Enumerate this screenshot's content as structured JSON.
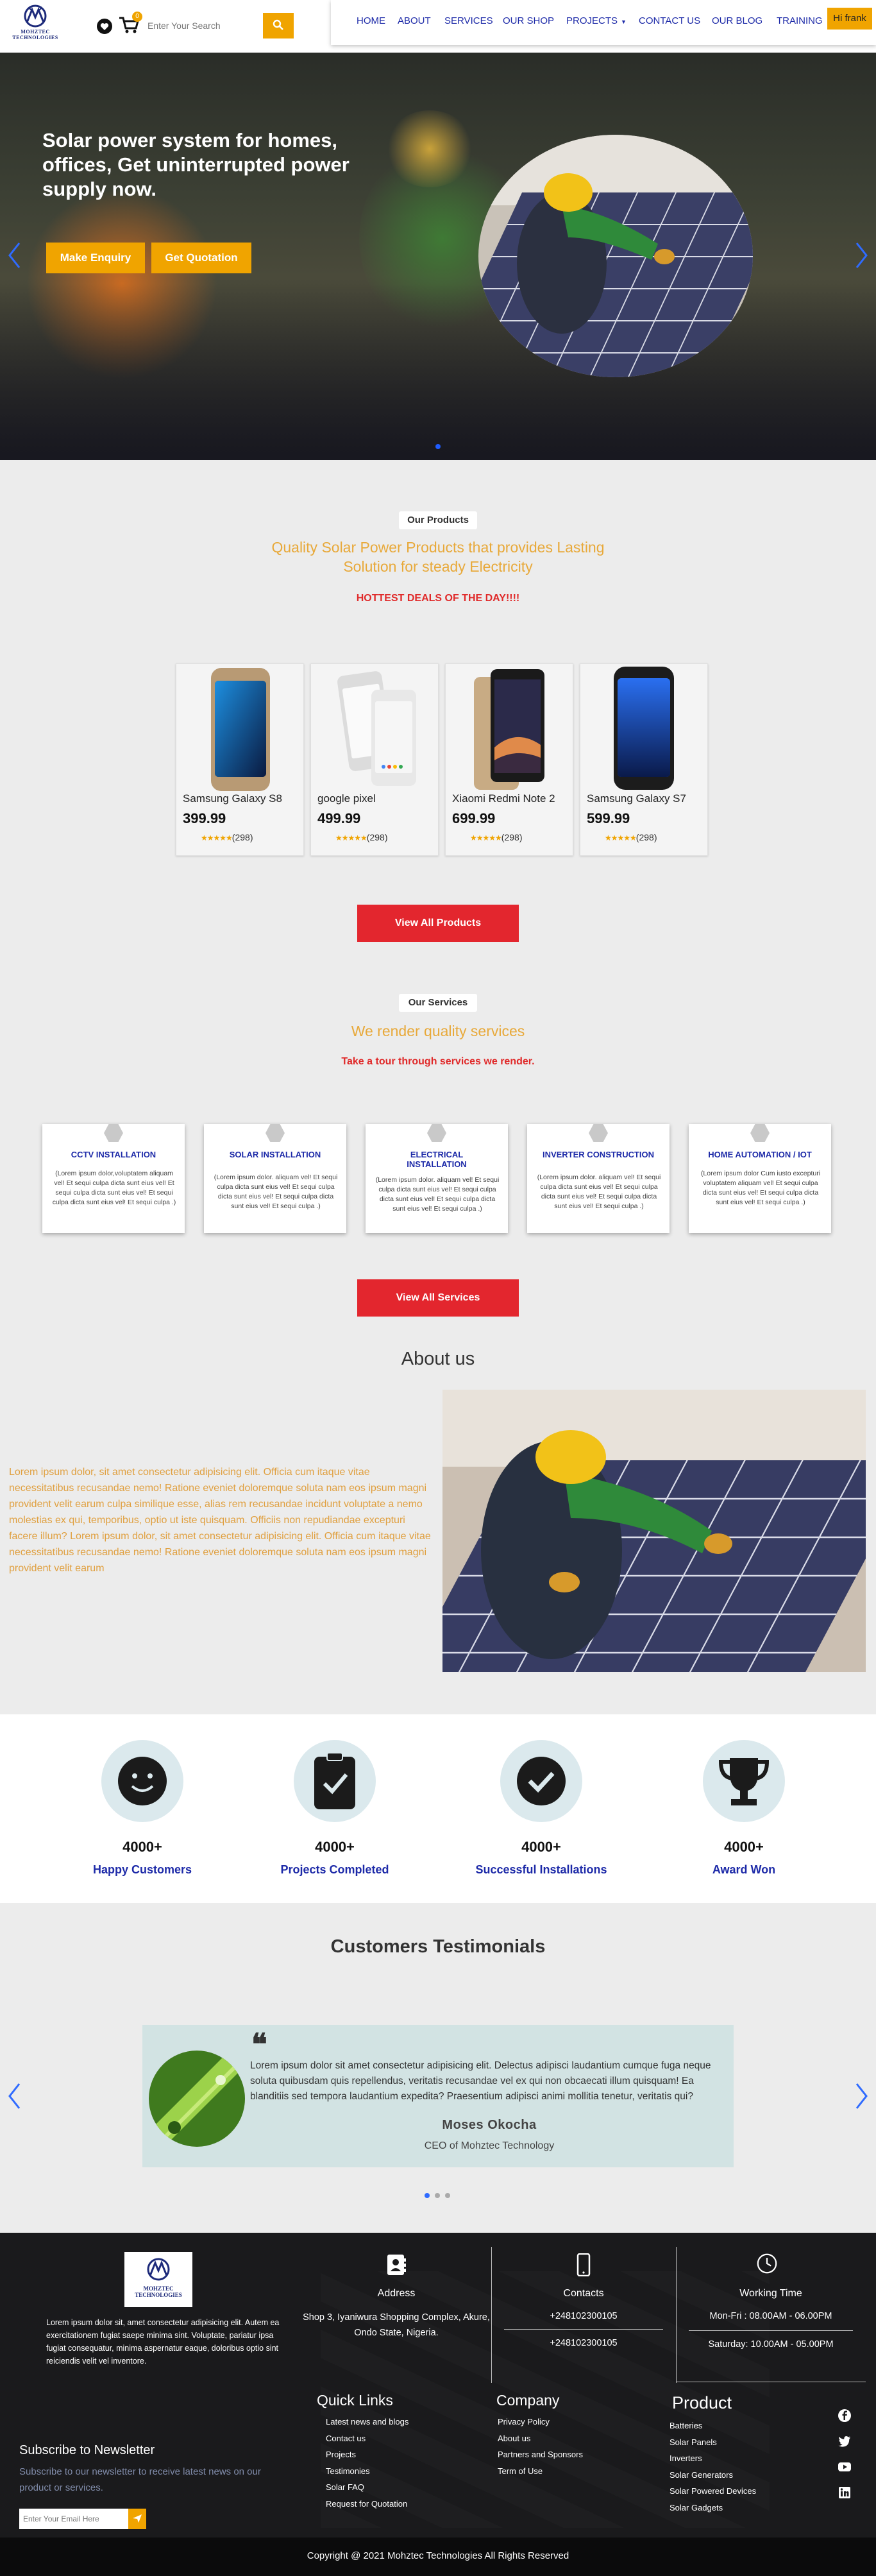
{
  "header": {
    "logo_text": "MOHZTEC TECHNOLOGIES",
    "cart_count": "0",
    "search_placeholder": "Enter Your Search",
    "nav": [
      {
        "label": "HOME"
      },
      {
        "label": "ABOUT"
      },
      {
        "label": "SERVICES"
      },
      {
        "label": "OUR SHOP"
      },
      {
        "label": "PROJECTS"
      },
      {
        "label": "CONTACT US"
      },
      {
        "label": "OUR BLOG"
      },
      {
        "label": "TRAINING"
      }
    ],
    "user_greeting": "Hi frank"
  },
  "hero": {
    "title": "Solar power system for homes, offices, Get uninterrupted power supply now.",
    "enquiry_label": "Make Enquiry",
    "quote_label": "Get Quotation"
  },
  "products": {
    "pill": "Our Products",
    "heading": "Quality Solar Power Products that provides Lasting Solution for steady Electricity",
    "subheading": "HOTTEST DEALS OF THE DAY!!!!",
    "items": [
      {
        "name": "Samsung Galaxy S8",
        "price": "399.99",
        "rating": "(298)",
        "stars": "★★★★★"
      },
      {
        "name": "google pixel",
        "price": "499.99",
        "rating": "(298)",
        "stars": "★★★★★"
      },
      {
        "name": "Xiaomi Redmi Note 2",
        "price": "699.99",
        "rating": "(298)",
        "stars": "★★★★★"
      },
      {
        "name": "Samsung Galaxy S7",
        "price": "599.99",
        "rating": "(298)",
        "stars": "★★★★★"
      }
    ],
    "view_all": "View All Products"
  },
  "services": {
    "pill": "Our Services",
    "heading": "We render quality services",
    "subheading": "Take a tour through services we render.",
    "items": [
      {
        "title": "CCTV INSTALLATION",
        "desc": "(Lorem ipsum dolor,voluptatem aliquam vel! Et sequi culpa dicta sunt eius vel! Et sequi culpa dicta sunt eius vel! Et sequi culpa dicta sunt eius vel! Et sequi culpa .)"
      },
      {
        "title": "SOLAR INSTALLATION",
        "desc": "(Lorem ipsum dolor. aliquam vel! Et sequi culpa dicta sunt eius vel! Et sequi culpa dicta sunt eius vel! Et sequi culpa dicta sunt eius vel! Et sequi culpa .)"
      },
      {
        "title": "ELECTRICAL INSTALLATION",
        "desc": "(Lorem ipsum dolor. aliquam vel! Et sequi culpa dicta sunt eius vel! Et sequi culpa dicta sunt eius vel! Et sequi culpa dicta sunt eius vel! Et sequi culpa .)"
      },
      {
        "title": "INVERTER CONSTRUCTION",
        "desc": "(Lorem ipsum dolor. aliquam vel! Et sequi culpa dicta sunt eius vel! Et sequi culpa dicta sunt eius vel! Et sequi culpa dicta sunt eius vel! Et sequi culpa .)"
      },
      {
        "title": "HOME AUTOMATION / IOT",
        "desc": "(Lorem ipsum dolor Cum iusto excepturi voluptatem aliquam vel! Et sequi culpa dicta sunt eius vel! Et sequi culpa dicta sunt eius vel! Et sequi culpa .)"
      }
    ],
    "view_all": "View All Services"
  },
  "about": {
    "title": "About us",
    "text": "Lorem ipsum dolor, sit amet consectetur adipisicing elit. Officia cum itaque vitae necessitatibus recusandae nemo! Ratione eveniet doloremque soluta nam eos ipsum magni provident velit earum culpa similique esse, alias rem recusandae incidunt voluptate a nemo molestias ex qui, temporibus, optio ut iste quisquam. Officiis non repudiandae excepturi facere illum? Lorem ipsum dolor, sit amet consectetur adipisicing elit. Officia cum itaque vitae necessitatibus recusandae nemo! Ratione eveniet doloremque soluta nam eos ipsum magni provident velit earum"
  },
  "stats": [
    {
      "number": "4000+",
      "label": "Happy Customers",
      "icon": "smile-icon"
    },
    {
      "number": "4000+",
      "label": "Projects Completed",
      "icon": "clipboard-check-icon"
    },
    {
      "number": "4000+",
      "label": "Successful Installations",
      "icon": "check-circle-icon"
    },
    {
      "number": "4000+",
      "label": "Award Won",
      "icon": "trophy-icon"
    }
  ],
  "testimonials": {
    "title": "Customers Testimonials",
    "text": "Lorem ipsum dolor sit amet consectetur adipisicing elit. Delectus adipisci laudantium cumque fuga neque soluta quibusdam quis repellendus, veritatis recusandae vel ex qui non obcaecati illum quisquam! Ea blanditiis sed tempora laudantium expedita? Praesentium adipisci animi mollitia tenetur, veritatis qui?",
    "name": "Moses Okocha",
    "role": "CEO of Mohztec Technology"
  },
  "footer": {
    "logo_text": "MOHZTEC TECHNOLOGIES",
    "about": "Lorem ipsum dolor sit, amet consectetur adipisicing elit. Autem ea exercitationem fugiat saepe minima sint. Voluptate, pariatur ipsa fugiat consequatur, minima aspernatur eaque, doloribus optio sint reiciendis velit vel inventore.",
    "address": {
      "heading": "Address",
      "text": "Shop 3, Iyaniwura Shopping Complex, Akure, Ondo State, Nigeria."
    },
    "contacts": {
      "heading": "Contacts",
      "phone1": "+248102300105",
      "phone2": "+248102300105"
    },
    "working": {
      "heading": "Working Time",
      "line1": "Mon-Fri : 08.00AM - 06.00PM",
      "line2": "Saturday: 10.00AM - 05.00PM"
    },
    "newsletter": {
      "heading": "Subscribe to Newsletter",
      "text": "Subscribe to our newsletter to receive latest news on our product or services.",
      "placeholder": "Enter Your Email Here"
    },
    "quick_links": {
      "heading": "Quick Links",
      "items": [
        "Latest news and blogs",
        "Contact us",
        "Projects",
        "Testimonies",
        "Solar FAQ",
        "Request for Quotation"
      ]
    },
    "company": {
      "heading": "Company",
      "items": [
        "Privacy Policy",
        "About us",
        "Partners and Sponsors",
        "Term of Use"
      ]
    },
    "product": {
      "heading": "Product",
      "items": [
        "Batteries",
        "Solar Panels",
        "Inverters",
        "Solar Generators",
        "Solar Powered Devices",
        "Solar Gadgets"
      ]
    },
    "copyright": "Copyright @ 2021 Mohztec Technologies All Rights Reserved"
  },
  "colors": {
    "accent": "#f0a400",
    "nav_blue": "#1d2aa8",
    "cta_red": "#e3262e"
  }
}
